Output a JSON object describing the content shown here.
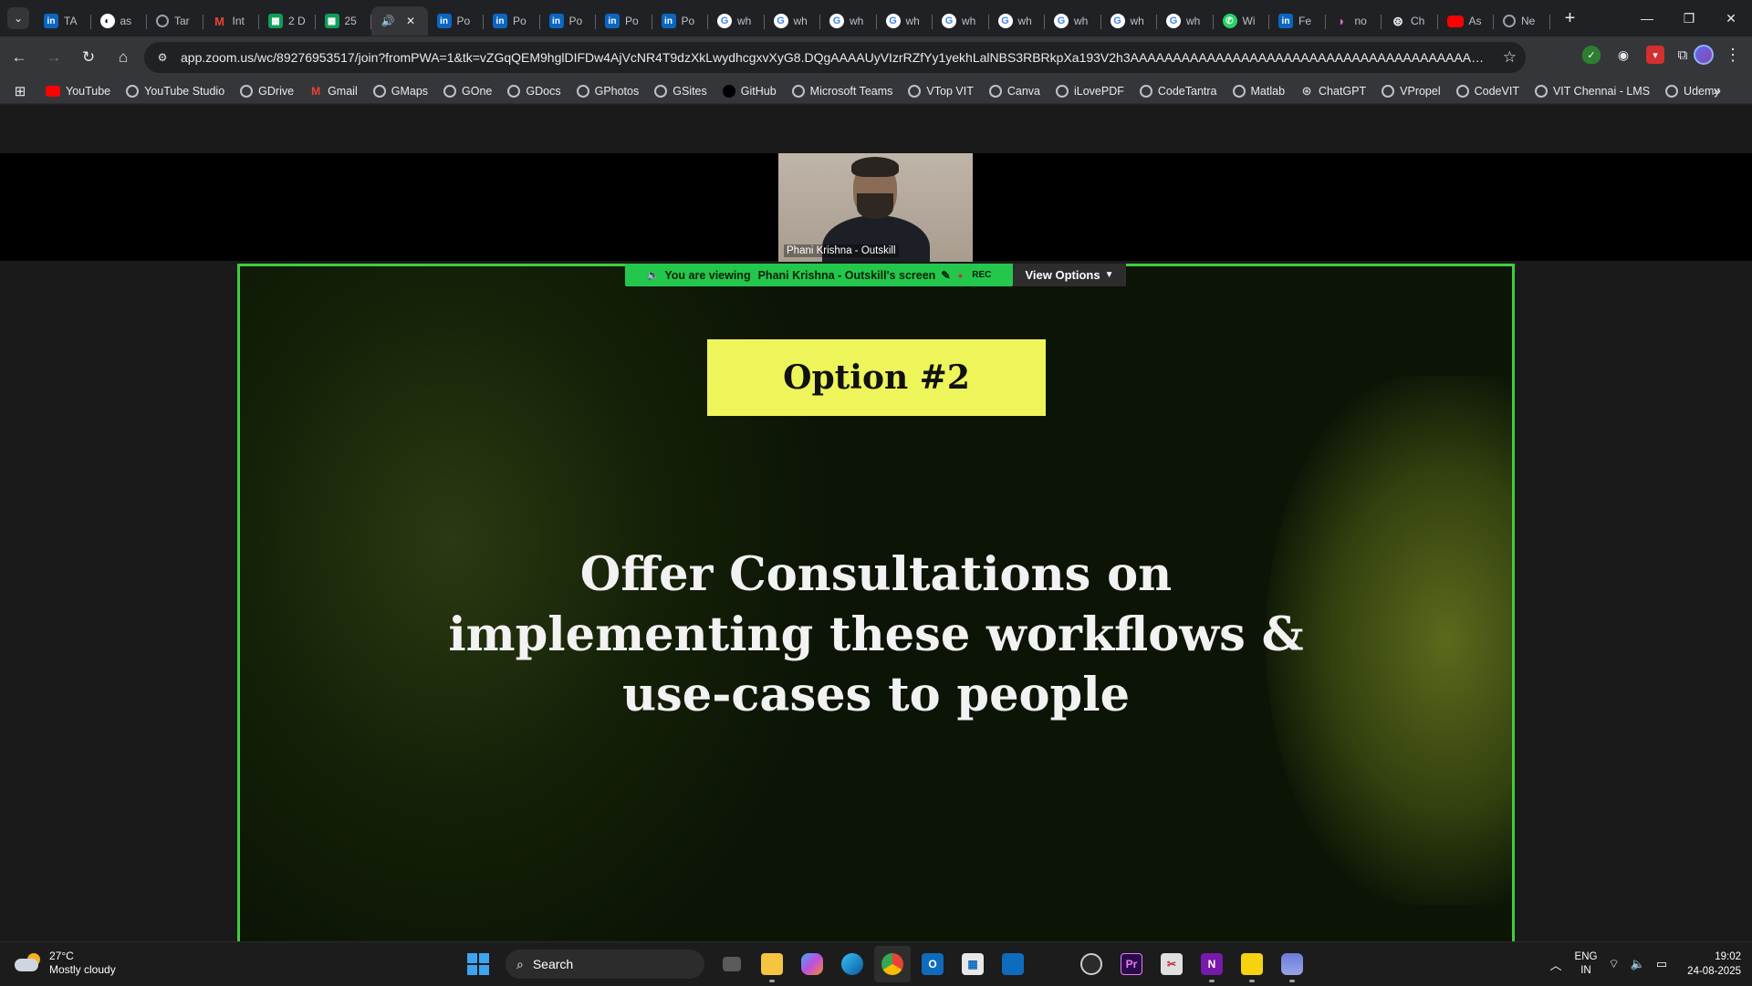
{
  "browser": {
    "tabs": [
      {
        "icon": "linkedin",
        "label": "TA"
      },
      {
        "icon": "github",
        "label": "as"
      },
      {
        "icon": "generic",
        "label": "Tar"
      },
      {
        "icon": "gmail",
        "label": "Int"
      },
      {
        "icon": "sheets",
        "label": "2 D"
      },
      {
        "icon": "sheets",
        "label": "25"
      },
      {
        "icon": "speaker",
        "label": "",
        "active": true
      },
      {
        "icon": "linkedin",
        "label": "Po"
      },
      {
        "icon": "linkedin",
        "label": "Po"
      },
      {
        "icon": "linkedin",
        "label": "Po"
      },
      {
        "icon": "linkedin",
        "label": "Po"
      },
      {
        "icon": "linkedin",
        "label": "Po"
      },
      {
        "icon": "google",
        "label": "wh"
      },
      {
        "icon": "google",
        "label": "wh"
      },
      {
        "icon": "google",
        "label": "wh"
      },
      {
        "icon": "google",
        "label": "wh"
      },
      {
        "icon": "google",
        "label": "wh"
      },
      {
        "icon": "google",
        "label": "wh"
      },
      {
        "icon": "google",
        "label": "wh"
      },
      {
        "icon": "google",
        "label": "wh"
      },
      {
        "icon": "google",
        "label": "wh"
      },
      {
        "icon": "whatsapp",
        "label": "Wi"
      },
      {
        "icon": "linkedin",
        "label": "Fe"
      },
      {
        "icon": "canva",
        "label": "no"
      },
      {
        "icon": "chatgpt",
        "label": "Ch"
      },
      {
        "icon": "youtube",
        "label": "As"
      },
      {
        "icon": "generic",
        "label": "Ne"
      }
    ],
    "url": "app.zoom.us/wc/89276953517/join?fromPWA=1&tk=vZGqQEM9hglDIFDw4AjVcNR4T9dzXkLwydhcgxvXyG8.DQgAAAAUyVIzrRZfYy1yekhLalNBS3RBRkpXa193V2h3AAAAAAAAAAAAAAAAAAAAAAAAAAAAAAAAAAAAAAAAAAAAAAAA&_x_zm_r...",
    "bookmarks": [
      "YouTube",
      "YouTube Studio",
      "GDrive",
      "Gmail",
      "GMaps",
      "GOne",
      "GDocs",
      "GPhotos",
      "GSites",
      "GitHub",
      "Microsoft Teams",
      "VTop VIT",
      "Canva",
      "iLovePDF",
      "CodeTantra",
      "Matlab",
      "ChatGPT",
      "VPropel",
      "CodeVIT",
      "VIT Chennai - LMS",
      "Udemy"
    ]
  },
  "meeting": {
    "participant_name": "Phani Krishna - Outskill",
    "viewing_prefix": "You are viewing",
    "viewing_name": "Phani Krishna - Outskill's screen",
    "rec_label": "REC",
    "view_options_label": "View Options"
  },
  "slide": {
    "option_label": "Option #2",
    "title": "Offer Consultations on implementing these workflows & use-cases to people"
  },
  "taskbar": {
    "temperature": "27°C",
    "weather": "Mostly cloudy",
    "search_label": "Search",
    "lang_1": "ENG",
    "lang_2": "IN",
    "time": "19:02",
    "date": "24-08-2025"
  },
  "colors": {
    "share_border": "#3ecf3e",
    "viewing_bar": "#23c74b",
    "option_box": "#eef55a"
  }
}
